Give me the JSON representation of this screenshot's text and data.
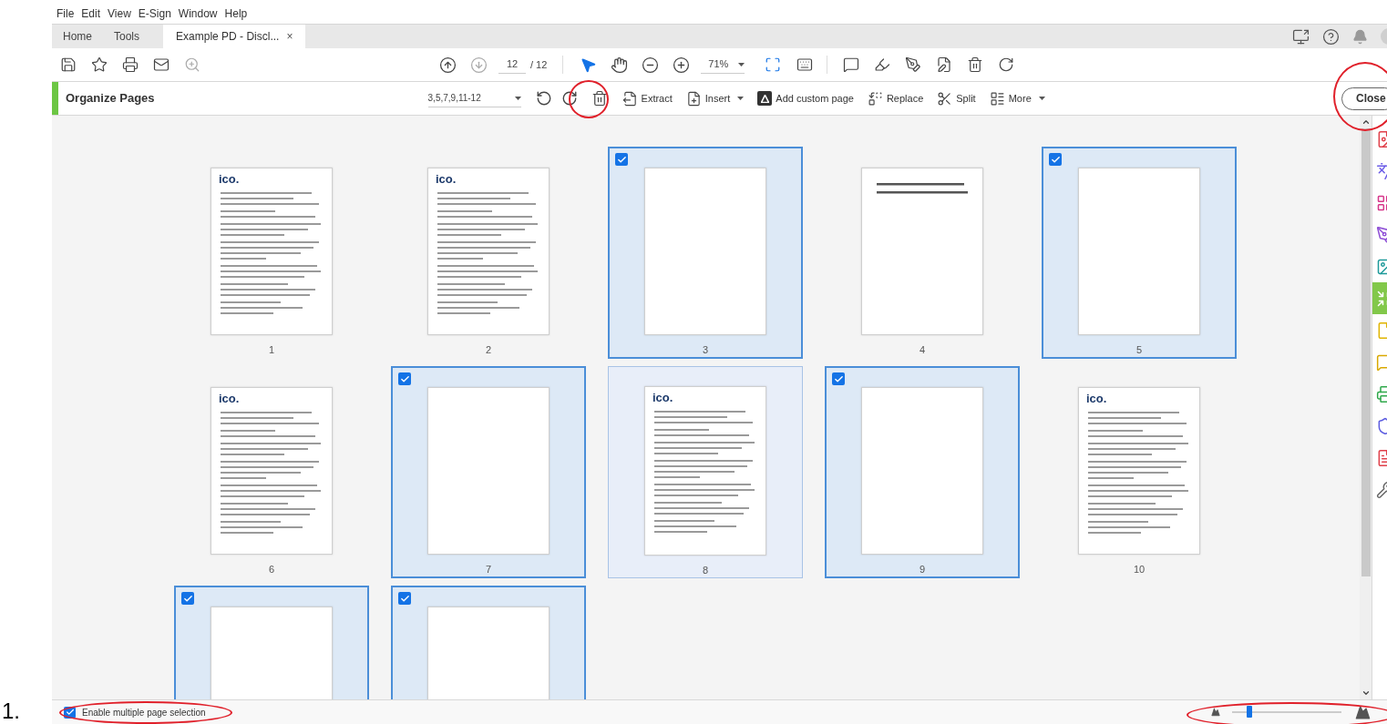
{
  "annotation_number": "1.",
  "menu": [
    "File",
    "Edit",
    "View",
    "E-Sign",
    "Window",
    "Help"
  ],
  "tabs": [
    {
      "label": "Home",
      "selected": false
    },
    {
      "label": "Tools",
      "selected": false
    },
    {
      "label": "Example PD - Discl...",
      "selected": true,
      "close": "×"
    }
  ],
  "toolbar": {
    "left": [
      {
        "kind": "save",
        "disabled": false
      },
      {
        "kind": "star",
        "disabled": false
      },
      {
        "kind": "print",
        "disabled": false
      },
      {
        "kind": "mail",
        "disabled": false
      },
      {
        "kind": "zoom-search",
        "disabled": true
      }
    ],
    "nav": [
      {
        "kind": "page-up",
        "disabled": false
      },
      {
        "kind": "page-down",
        "disabled": true
      }
    ],
    "page_number": "12",
    "page_total": "/ 12",
    "tools": [
      {
        "kind": "pointer",
        "selected": true
      },
      {
        "kind": "hand",
        "selected": false
      },
      {
        "kind": "zoom-out",
        "selected": false
      },
      {
        "kind": "zoom-in",
        "selected": false
      }
    ],
    "zoom": "71%",
    "right": [
      {
        "kind": "fit"
      },
      {
        "kind": "keyboard"
      },
      {
        "kind": "comment"
      },
      {
        "kind": "highlight"
      },
      {
        "kind": "sign"
      },
      {
        "kind": "edit-file"
      },
      {
        "kind": "delete"
      },
      {
        "kind": "rotate"
      }
    ]
  },
  "organize": {
    "title": "Organize Pages",
    "range": "3,5,7,9,11-12",
    "actions": [
      {
        "kind": "extract",
        "label": "Extract"
      },
      {
        "kind": "insert",
        "label": "Insert",
        "dropdown": true
      },
      {
        "kind": "custom",
        "label": "Add custom page"
      },
      {
        "kind": "replace",
        "label": "Replace"
      },
      {
        "kind": "split",
        "label": "Split"
      },
      {
        "kind": "more",
        "label": "More",
        "dropdown": true
      }
    ],
    "close": "Close"
  },
  "pages": [
    {
      "label": "1",
      "selected": false,
      "kind": "letter",
      "logo": "ico."
    },
    {
      "label": "2",
      "selected": false,
      "kind": "letter",
      "logo": "ico."
    },
    {
      "label": "3",
      "selected": true,
      "kind": "blank"
    },
    {
      "label": "4",
      "selected": false,
      "kind": "heading"
    },
    {
      "label": "5",
      "selected": true,
      "kind": "blank"
    },
    {
      "label": "6",
      "selected": false,
      "kind": "letter",
      "logo": "ico."
    },
    {
      "label": "7",
      "selected": true,
      "kind": "blank"
    },
    {
      "label": "8",
      "selected": false,
      "highlighted": true,
      "kind": "letter",
      "logo": "ico."
    },
    {
      "label": "9",
      "selected": true,
      "kind": "blank"
    },
    {
      "label": "10",
      "selected": false,
      "kind": "letter",
      "logo": "ico."
    },
    {
      "selected": true,
      "kind": "blank"
    },
    {
      "selected": true,
      "kind": "blank"
    }
  ],
  "side_tools": [
    {
      "kind": "file-image",
      "color": "#e0404a",
      "selected": false
    },
    {
      "kind": "translate",
      "color": "#6b5ce7",
      "selected": false
    },
    {
      "kind": "grid",
      "color": "#d6358a",
      "selected": false
    },
    {
      "kind": "pen",
      "color": "#8e4fd6",
      "selected": false
    },
    {
      "kind": "image",
      "color": "#1e9a9a",
      "selected": false
    },
    {
      "kind": "organize",
      "color": "#ffffff",
      "selected": true
    },
    {
      "kind": "file",
      "color": "#e0b400",
      "selected": false
    },
    {
      "kind": "comment",
      "color": "#d9a800",
      "selected": false
    },
    {
      "kind": "print",
      "color": "#2ea84a",
      "selected": false
    },
    {
      "kind": "shield",
      "color": "#5b5be0",
      "selected": false
    },
    {
      "kind": "file-text",
      "color": "#e0404a",
      "selected": false
    },
    {
      "kind": "wrench",
      "color": "#666666",
      "selected": false
    }
  ],
  "footer": {
    "multi_select": {
      "label": "Enable multiple page selection",
      "checked": true
    },
    "zoom_slider": {
      "level": 0.16
    }
  }
}
